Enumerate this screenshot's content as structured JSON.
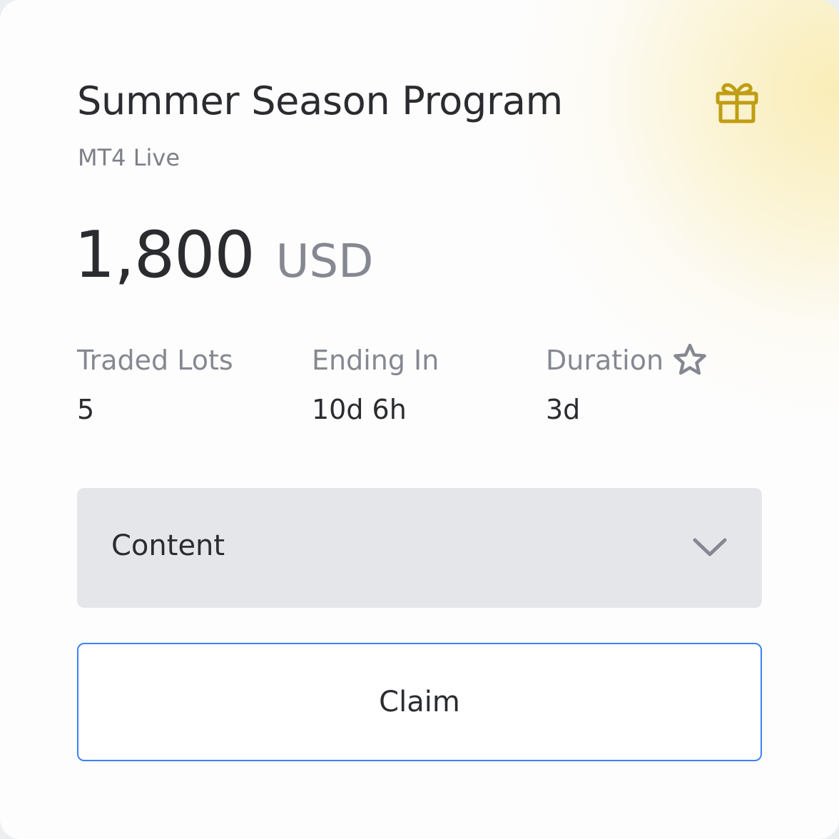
{
  "program": {
    "title": "Summer Season Program",
    "account_type": "MT4 Live",
    "icon": "gift-icon"
  },
  "reward": {
    "amount": "1,800",
    "currency": "USD"
  },
  "stats": [
    {
      "label": "Traded Lots",
      "value": "5"
    },
    {
      "label": "Ending In",
      "value": "10d 6h"
    },
    {
      "label": "Duration",
      "value": "3d",
      "icon": "star-icon"
    }
  ],
  "content_dropdown": {
    "label": "Content",
    "icon": "chevron-down-icon"
  },
  "claim_button": {
    "label": "Claim"
  },
  "colors": {
    "accent_gold": "#BF9E14",
    "button_border": "#3B82F6",
    "text_primary": "#2A2C30",
    "text_muted": "#858891",
    "dropdown_bg": "#E4E6EA"
  }
}
